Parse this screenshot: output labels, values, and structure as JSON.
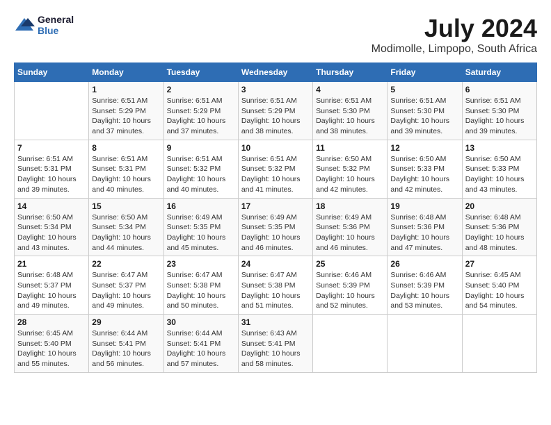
{
  "logo": {
    "line1": "General",
    "line2": "Blue"
  },
  "title": "July 2024",
  "location": "Modimolle, Limpopo, South Africa",
  "days_of_week": [
    "Sunday",
    "Monday",
    "Tuesday",
    "Wednesday",
    "Thursday",
    "Friday",
    "Saturday"
  ],
  "weeks": [
    [
      {
        "day": "",
        "content": ""
      },
      {
        "day": "1",
        "content": "Sunrise: 6:51 AM\nSunset: 5:29 PM\nDaylight: 10 hours\nand 37 minutes."
      },
      {
        "day": "2",
        "content": "Sunrise: 6:51 AM\nSunset: 5:29 PM\nDaylight: 10 hours\nand 37 minutes."
      },
      {
        "day": "3",
        "content": "Sunrise: 6:51 AM\nSunset: 5:29 PM\nDaylight: 10 hours\nand 38 minutes."
      },
      {
        "day": "4",
        "content": "Sunrise: 6:51 AM\nSunset: 5:30 PM\nDaylight: 10 hours\nand 38 minutes."
      },
      {
        "day": "5",
        "content": "Sunrise: 6:51 AM\nSunset: 5:30 PM\nDaylight: 10 hours\nand 39 minutes."
      },
      {
        "day": "6",
        "content": "Sunrise: 6:51 AM\nSunset: 5:30 PM\nDaylight: 10 hours\nand 39 minutes."
      }
    ],
    [
      {
        "day": "7",
        "content": "Sunrise: 6:51 AM\nSunset: 5:31 PM\nDaylight: 10 hours\nand 39 minutes."
      },
      {
        "day": "8",
        "content": "Sunrise: 6:51 AM\nSunset: 5:31 PM\nDaylight: 10 hours\nand 40 minutes."
      },
      {
        "day": "9",
        "content": "Sunrise: 6:51 AM\nSunset: 5:32 PM\nDaylight: 10 hours\nand 40 minutes."
      },
      {
        "day": "10",
        "content": "Sunrise: 6:51 AM\nSunset: 5:32 PM\nDaylight: 10 hours\nand 41 minutes."
      },
      {
        "day": "11",
        "content": "Sunrise: 6:50 AM\nSunset: 5:32 PM\nDaylight: 10 hours\nand 42 minutes."
      },
      {
        "day": "12",
        "content": "Sunrise: 6:50 AM\nSunset: 5:33 PM\nDaylight: 10 hours\nand 42 minutes."
      },
      {
        "day": "13",
        "content": "Sunrise: 6:50 AM\nSunset: 5:33 PM\nDaylight: 10 hours\nand 43 minutes."
      }
    ],
    [
      {
        "day": "14",
        "content": "Sunrise: 6:50 AM\nSunset: 5:34 PM\nDaylight: 10 hours\nand 43 minutes."
      },
      {
        "day": "15",
        "content": "Sunrise: 6:50 AM\nSunset: 5:34 PM\nDaylight: 10 hours\nand 44 minutes."
      },
      {
        "day": "16",
        "content": "Sunrise: 6:49 AM\nSunset: 5:35 PM\nDaylight: 10 hours\nand 45 minutes."
      },
      {
        "day": "17",
        "content": "Sunrise: 6:49 AM\nSunset: 5:35 PM\nDaylight: 10 hours\nand 46 minutes."
      },
      {
        "day": "18",
        "content": "Sunrise: 6:49 AM\nSunset: 5:36 PM\nDaylight: 10 hours\nand 46 minutes."
      },
      {
        "day": "19",
        "content": "Sunrise: 6:48 AM\nSunset: 5:36 PM\nDaylight: 10 hours\nand 47 minutes."
      },
      {
        "day": "20",
        "content": "Sunrise: 6:48 AM\nSunset: 5:36 PM\nDaylight: 10 hours\nand 48 minutes."
      }
    ],
    [
      {
        "day": "21",
        "content": "Sunrise: 6:48 AM\nSunset: 5:37 PM\nDaylight: 10 hours\nand 49 minutes."
      },
      {
        "day": "22",
        "content": "Sunrise: 6:47 AM\nSunset: 5:37 PM\nDaylight: 10 hours\nand 49 minutes."
      },
      {
        "day": "23",
        "content": "Sunrise: 6:47 AM\nSunset: 5:38 PM\nDaylight: 10 hours\nand 50 minutes."
      },
      {
        "day": "24",
        "content": "Sunrise: 6:47 AM\nSunset: 5:38 PM\nDaylight: 10 hours\nand 51 minutes."
      },
      {
        "day": "25",
        "content": "Sunrise: 6:46 AM\nSunset: 5:39 PM\nDaylight: 10 hours\nand 52 minutes."
      },
      {
        "day": "26",
        "content": "Sunrise: 6:46 AM\nSunset: 5:39 PM\nDaylight: 10 hours\nand 53 minutes."
      },
      {
        "day": "27",
        "content": "Sunrise: 6:45 AM\nSunset: 5:40 PM\nDaylight: 10 hours\nand 54 minutes."
      }
    ],
    [
      {
        "day": "28",
        "content": "Sunrise: 6:45 AM\nSunset: 5:40 PM\nDaylight: 10 hours\nand 55 minutes."
      },
      {
        "day": "29",
        "content": "Sunrise: 6:44 AM\nSunset: 5:41 PM\nDaylight: 10 hours\nand 56 minutes."
      },
      {
        "day": "30",
        "content": "Sunrise: 6:44 AM\nSunset: 5:41 PM\nDaylight: 10 hours\nand 57 minutes."
      },
      {
        "day": "31",
        "content": "Sunrise: 6:43 AM\nSunset: 5:41 PM\nDaylight: 10 hours\nand 58 minutes."
      },
      {
        "day": "",
        "content": ""
      },
      {
        "day": "",
        "content": ""
      },
      {
        "day": "",
        "content": ""
      }
    ]
  ]
}
